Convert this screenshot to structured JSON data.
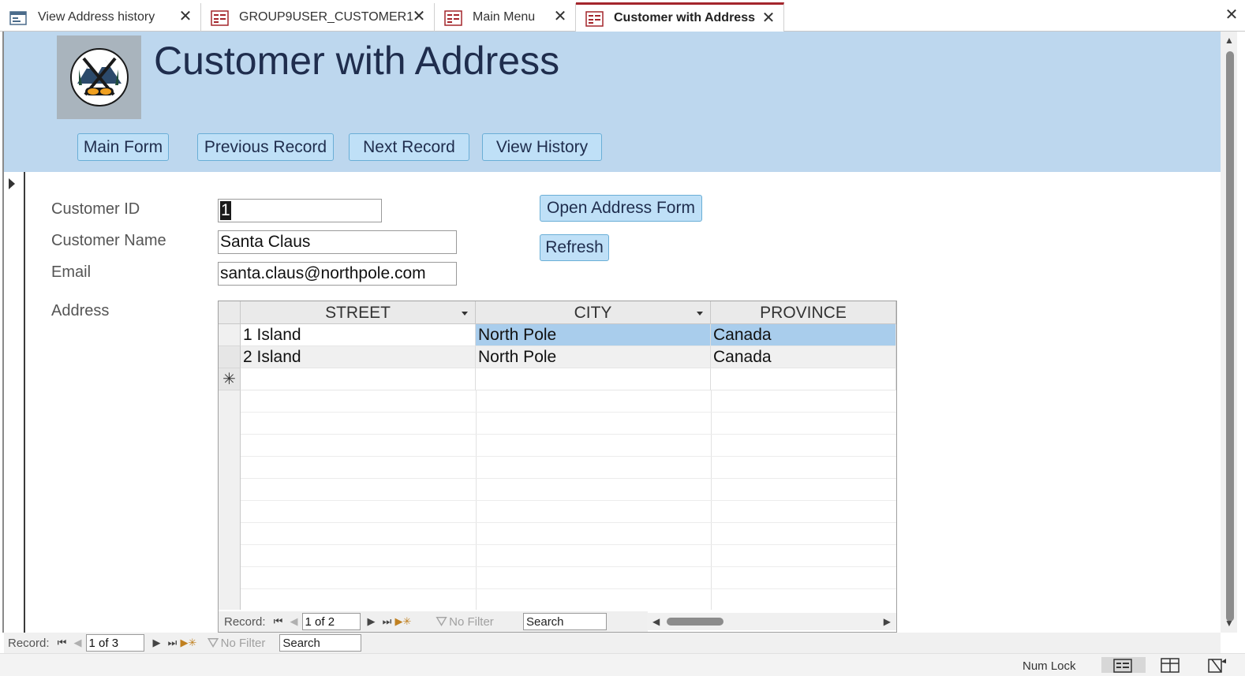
{
  "tabs": [
    {
      "label": "View Address history",
      "active": false
    },
    {
      "label": "GROUP9USER_CUSTOMER1",
      "active": false
    },
    {
      "label": "Main Menu",
      "active": false
    },
    {
      "label": "Customer with Address",
      "active": true
    }
  ],
  "header": {
    "title": "Customer with Address",
    "buttons": {
      "main_form": "Main Form",
      "previous_record": "Previous Record",
      "next_record": "Next Record",
      "view_history": "View History"
    }
  },
  "form": {
    "customer_id_label": "Customer ID",
    "customer_id_value": "1",
    "customer_name_label": "Customer Name",
    "customer_name_value": "Santa Claus",
    "email_label": "Email",
    "email_value": "santa.claus@northpole.com",
    "address_label": "Address",
    "open_address_button": "Open Address Form",
    "refresh_button": "Refresh"
  },
  "address_grid": {
    "columns": [
      "STREET",
      "CITY",
      "PROVINCE"
    ],
    "rows": [
      {
        "street": "1 Island",
        "city": "North Pole",
        "province": "Canada"
      },
      {
        "street": "2 Island",
        "city": "North Pole",
        "province": "Canada"
      }
    ],
    "new_row_marker": "✳"
  },
  "subform_nav": {
    "label": "Record:",
    "position": "1 of 2",
    "filter": "No Filter",
    "search": "Search"
  },
  "main_nav": {
    "label": "Record:",
    "position": "1 of 3",
    "filter": "No Filter",
    "search": "Search"
  },
  "status": {
    "num_lock": "Num Lock"
  },
  "colors": {
    "header_bg": "#bdd7ee",
    "button_bg": "#bfe0f7",
    "title_color": "#1f2d4d",
    "selected_cell": "#a9cdec",
    "active_tab_accent": "#a4262c"
  }
}
